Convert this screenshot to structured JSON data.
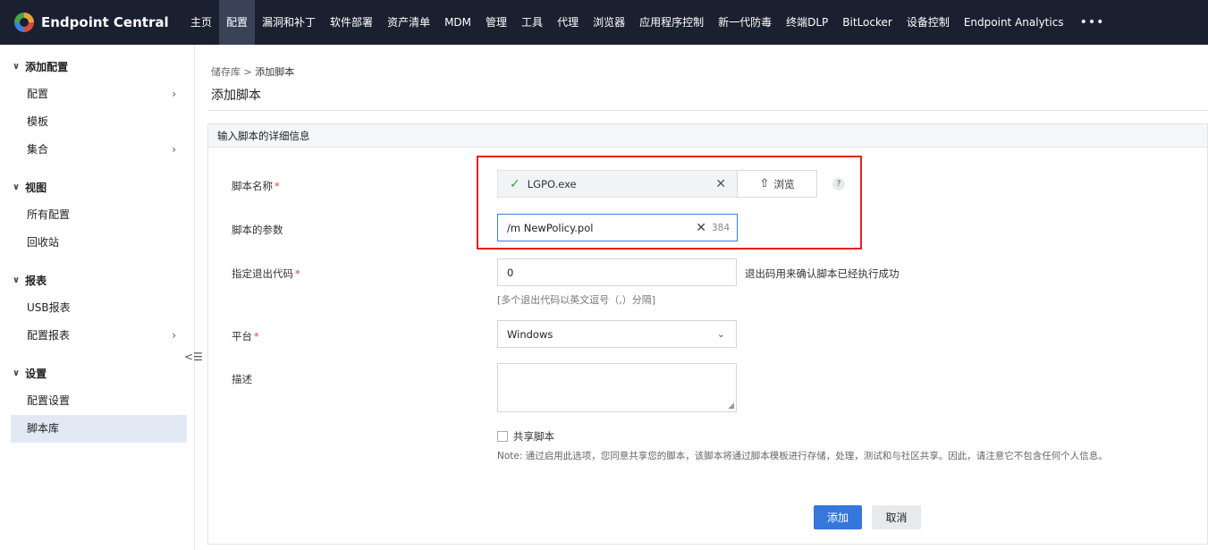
{
  "app": {
    "brand": "Endpoint Central"
  },
  "nav": {
    "items": [
      "主页",
      "配置",
      "漏洞和补丁",
      "软件部署",
      "资产清单",
      "MDM",
      "管理",
      "工具",
      "代理",
      "浏览器",
      "应用程序控制",
      "新一代防毒",
      "终端DLP",
      "BitLocker",
      "设备控制",
      "Endpoint Analytics"
    ],
    "active_index": 1,
    "more": "•••"
  },
  "sidebar": {
    "groups": [
      {
        "title": "添加配置",
        "items": [
          {
            "label": "配置",
            "arrow": "›"
          },
          {
            "label": "模板"
          },
          {
            "label": "集合",
            "arrow": "›"
          }
        ]
      },
      {
        "title": "视图",
        "items": [
          {
            "label": "所有配置"
          },
          {
            "label": "回收站"
          }
        ]
      },
      {
        "title": "报表",
        "items": [
          {
            "label": "USB报表"
          },
          {
            "label": "配置报表",
            "arrow": "›"
          }
        ]
      },
      {
        "title": "设置",
        "items": [
          {
            "label": "配置设置"
          },
          {
            "label": "脚本库",
            "active": true
          }
        ]
      }
    ]
  },
  "breadcrumb": {
    "parent": "储存库",
    "separator": ">",
    "current": "添加脚本"
  },
  "page": {
    "title": "添加脚本"
  },
  "panel": {
    "header": "输入脚本的详细信息"
  },
  "form": {
    "script_name": {
      "label": "脚本名称",
      "file": "LGPO.exe",
      "browse": "浏览",
      "help": "?"
    },
    "script_params": {
      "label": "脚本的参数",
      "value": "/m NewPolicy.pol",
      "remaining": "384"
    },
    "exit_code": {
      "label": "指定退出代码",
      "value": "0",
      "hint": "[多个退出代码以英文逗号（,）分隔]",
      "side_note": "退出码用来确认脚本已经执行成功"
    },
    "platform": {
      "label": "平台",
      "value": "Windows"
    },
    "description": {
      "label": "描述",
      "value": ""
    },
    "share": {
      "label": "共享脚本",
      "note": "Note: 通过启用此选项，您同意共享您的脚本，该脚本将通过脚本模板进行存储，处理，测试和与社区共享。因此，请注意它不包含任何个人信息。"
    },
    "required_mark": "*"
  },
  "actions": {
    "add": "添加",
    "cancel": "取消"
  },
  "colors": {
    "topbar": "#1b2030",
    "primary": "#3577db",
    "highlight_box": "#e32222",
    "success": "#2aa44f"
  }
}
